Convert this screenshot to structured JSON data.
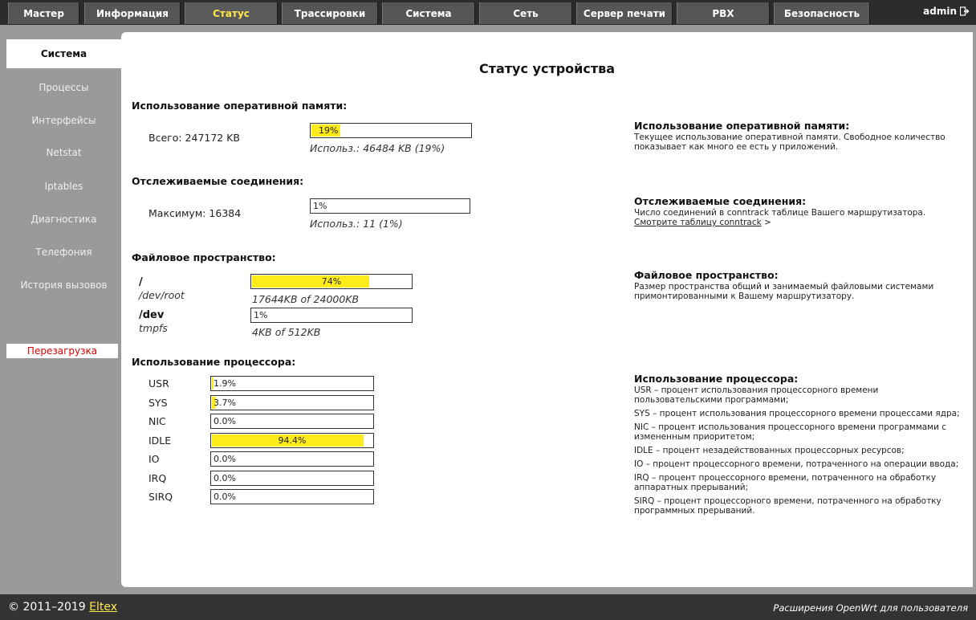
{
  "nav": {
    "tabs": [
      "Мастер",
      "Информация",
      "Статус",
      "Трассировки",
      "Система",
      "Сеть",
      "Сервер печати",
      "PBX",
      "Безопасность"
    ],
    "active": "Статус",
    "user": "admin",
    "logout_icon": "logout-icon"
  },
  "sidebar": {
    "items": [
      "Система",
      "Процессы",
      "Интерфейсы",
      "Netstat",
      "Iptables",
      "Диагностика",
      "Телефония",
      "История вызовов"
    ],
    "active": "Система",
    "reboot": "Перезагрузка"
  },
  "main": {
    "title": "Статус устройства",
    "memory": {
      "heading": "Использование оперативной памяти:",
      "total": "Всего: 247172 KB",
      "percent": 19,
      "percent_label": "19%",
      "note": "Использ.: 46484 KB (19%)"
    },
    "conn": {
      "heading": "Отслеживаемые соединения:",
      "max": "Максимум: 16384",
      "percent": 1,
      "percent_label": "1%",
      "note": "Использ.: 11 (1%)"
    },
    "fs": {
      "heading": "Файловое пространство:",
      "items": [
        {
          "mount": "/",
          "dev": "/dev/root",
          "percent": 74,
          "percent_label": "74%",
          "note": "17644KB of 24000KB"
        },
        {
          "mount": "/dev",
          "dev": "tmpfs",
          "percent": 1,
          "percent_label": "1%",
          "note": "4KB of 512KB"
        }
      ]
    },
    "cpu": {
      "heading": "Использование процессора:",
      "rows": [
        {
          "name": "USR",
          "value": 1.9,
          "label": "1.9%"
        },
        {
          "name": "SYS",
          "value": 3.7,
          "label": "3.7%"
        },
        {
          "name": "NIC",
          "value": 0.0,
          "label": "0.0%"
        },
        {
          "name": "IDLE",
          "value": 94.4,
          "label": "94.4%"
        },
        {
          "name": "IO",
          "value": 0.0,
          "label": "0.0%"
        },
        {
          "name": "IRQ",
          "value": 0.0,
          "label": "0.0%"
        },
        {
          "name": "SIRQ",
          "value": 0.0,
          "label": "0.0%"
        }
      ]
    }
  },
  "help": {
    "memory": {
      "title": "Использование оперативной памяти:",
      "text": "Текущее использование оперативной памяти. Свободное количество показывает как много ее есть у приложений."
    },
    "conn": {
      "title": "Отслеживаемые соединения:",
      "text": "Число соединений в conntrack таблице Вашего маршрутизатора.",
      "link": "Смотрите таблицу conntrack",
      "link_suffix": " >"
    },
    "fs": {
      "title": "Файловое пространство:",
      "text": "Размер пространства общий и занимаемый файловыми системами примонтированными к Вашему маршрутизатору."
    },
    "cpu": {
      "title": "Использование процессора:",
      "items": [
        "USR – процент использования процессорного времени пользовательскими программами;",
        "SYS – процент использования процессорного времени процессами ядра;",
        "NIC – процент использования процессорного времени программами с измененным приоритетом;",
        "IDLE – процент незадействованных процессорных ресурсов;",
        "IO – процент процессорного времени, потраченного на операции ввода;",
        "IRQ – процент процессорного времени, потраченного на обработку аппаратных прерываний;",
        "SIRQ – процент процессорного времени, потраченного на обработку программных прерываний."
      ]
    }
  },
  "footer": {
    "copyright": "© 2011–2019 ",
    "brand": "Eltex",
    "ext": "Расширения OpenWrt для пользователя"
  },
  "colors": {
    "accent": "#ffe84a",
    "bar_fill": "#ffeb1a",
    "reboot": "#dd0000"
  }
}
